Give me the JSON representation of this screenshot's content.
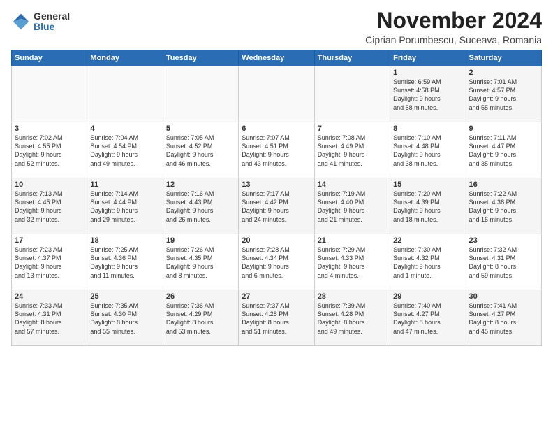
{
  "logo": {
    "general": "General",
    "blue": "Blue"
  },
  "title": "November 2024",
  "subtitle": "Ciprian Porumbescu, Suceava, Romania",
  "days_header": [
    "Sunday",
    "Monday",
    "Tuesday",
    "Wednesday",
    "Thursday",
    "Friday",
    "Saturday"
  ],
  "weeks": [
    [
      {
        "day": "",
        "info": ""
      },
      {
        "day": "",
        "info": ""
      },
      {
        "day": "",
        "info": ""
      },
      {
        "day": "",
        "info": ""
      },
      {
        "day": "",
        "info": ""
      },
      {
        "day": "1",
        "info": "Sunrise: 6:59 AM\nSunset: 4:58 PM\nDaylight: 9 hours\nand 58 minutes."
      },
      {
        "day": "2",
        "info": "Sunrise: 7:01 AM\nSunset: 4:57 PM\nDaylight: 9 hours\nand 55 minutes."
      }
    ],
    [
      {
        "day": "3",
        "info": "Sunrise: 7:02 AM\nSunset: 4:55 PM\nDaylight: 9 hours\nand 52 minutes."
      },
      {
        "day": "4",
        "info": "Sunrise: 7:04 AM\nSunset: 4:54 PM\nDaylight: 9 hours\nand 49 minutes."
      },
      {
        "day": "5",
        "info": "Sunrise: 7:05 AM\nSunset: 4:52 PM\nDaylight: 9 hours\nand 46 minutes."
      },
      {
        "day": "6",
        "info": "Sunrise: 7:07 AM\nSunset: 4:51 PM\nDaylight: 9 hours\nand 43 minutes."
      },
      {
        "day": "7",
        "info": "Sunrise: 7:08 AM\nSunset: 4:49 PM\nDaylight: 9 hours\nand 41 minutes."
      },
      {
        "day": "8",
        "info": "Sunrise: 7:10 AM\nSunset: 4:48 PM\nDaylight: 9 hours\nand 38 minutes."
      },
      {
        "day": "9",
        "info": "Sunrise: 7:11 AM\nSunset: 4:47 PM\nDaylight: 9 hours\nand 35 minutes."
      }
    ],
    [
      {
        "day": "10",
        "info": "Sunrise: 7:13 AM\nSunset: 4:45 PM\nDaylight: 9 hours\nand 32 minutes."
      },
      {
        "day": "11",
        "info": "Sunrise: 7:14 AM\nSunset: 4:44 PM\nDaylight: 9 hours\nand 29 minutes."
      },
      {
        "day": "12",
        "info": "Sunrise: 7:16 AM\nSunset: 4:43 PM\nDaylight: 9 hours\nand 26 minutes."
      },
      {
        "day": "13",
        "info": "Sunrise: 7:17 AM\nSunset: 4:42 PM\nDaylight: 9 hours\nand 24 minutes."
      },
      {
        "day": "14",
        "info": "Sunrise: 7:19 AM\nSunset: 4:40 PM\nDaylight: 9 hours\nand 21 minutes."
      },
      {
        "day": "15",
        "info": "Sunrise: 7:20 AM\nSunset: 4:39 PM\nDaylight: 9 hours\nand 18 minutes."
      },
      {
        "day": "16",
        "info": "Sunrise: 7:22 AM\nSunset: 4:38 PM\nDaylight: 9 hours\nand 16 minutes."
      }
    ],
    [
      {
        "day": "17",
        "info": "Sunrise: 7:23 AM\nSunset: 4:37 PM\nDaylight: 9 hours\nand 13 minutes."
      },
      {
        "day": "18",
        "info": "Sunrise: 7:25 AM\nSunset: 4:36 PM\nDaylight: 9 hours\nand 11 minutes."
      },
      {
        "day": "19",
        "info": "Sunrise: 7:26 AM\nSunset: 4:35 PM\nDaylight: 9 hours\nand 8 minutes."
      },
      {
        "day": "20",
        "info": "Sunrise: 7:28 AM\nSunset: 4:34 PM\nDaylight: 9 hours\nand 6 minutes."
      },
      {
        "day": "21",
        "info": "Sunrise: 7:29 AM\nSunset: 4:33 PM\nDaylight: 9 hours\nand 4 minutes."
      },
      {
        "day": "22",
        "info": "Sunrise: 7:30 AM\nSunset: 4:32 PM\nDaylight: 9 hours\nand 1 minute."
      },
      {
        "day": "23",
        "info": "Sunrise: 7:32 AM\nSunset: 4:31 PM\nDaylight: 8 hours\nand 59 minutes."
      }
    ],
    [
      {
        "day": "24",
        "info": "Sunrise: 7:33 AM\nSunset: 4:31 PM\nDaylight: 8 hours\nand 57 minutes."
      },
      {
        "day": "25",
        "info": "Sunrise: 7:35 AM\nSunset: 4:30 PM\nDaylight: 8 hours\nand 55 minutes."
      },
      {
        "day": "26",
        "info": "Sunrise: 7:36 AM\nSunset: 4:29 PM\nDaylight: 8 hours\nand 53 minutes."
      },
      {
        "day": "27",
        "info": "Sunrise: 7:37 AM\nSunset: 4:28 PM\nDaylight: 8 hours\nand 51 minutes."
      },
      {
        "day": "28",
        "info": "Sunrise: 7:39 AM\nSunset: 4:28 PM\nDaylight: 8 hours\nand 49 minutes."
      },
      {
        "day": "29",
        "info": "Sunrise: 7:40 AM\nSunset: 4:27 PM\nDaylight: 8 hours\nand 47 minutes."
      },
      {
        "day": "30",
        "info": "Sunrise: 7:41 AM\nSunset: 4:27 PM\nDaylight: 8 hours\nand 45 minutes."
      }
    ]
  ]
}
